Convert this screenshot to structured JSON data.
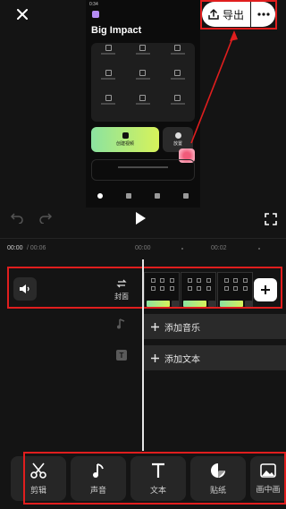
{
  "topbar": {
    "export_label": "导出"
  },
  "preview": {
    "status_time": "0:34",
    "title": "Big Impact",
    "create_label": "创建视频",
    "side_label": "放置"
  },
  "timeline": {
    "current_time": "00:00",
    "total_time": "/ 00:06",
    "ticks": [
      "00:00",
      "00:02"
    ],
    "cover_label": "封面",
    "add_music_label": "添加音乐",
    "add_text_label": "添加文本"
  },
  "toolbar": {
    "items": [
      {
        "label": "剪辑",
        "icon": "scissors-icon"
      },
      {
        "label": "声音",
        "icon": "music-note-icon"
      },
      {
        "label": "文本",
        "icon": "text-icon"
      },
      {
        "label": "贴纸",
        "icon": "sticker-icon"
      },
      {
        "label": "画中画",
        "icon": "picture-in-picture-icon"
      }
    ]
  },
  "colors": {
    "annotation": "#e01e1e",
    "accent_gradient_start": "#8be3a0",
    "accent_gradient_end": "#d7f25a"
  }
}
